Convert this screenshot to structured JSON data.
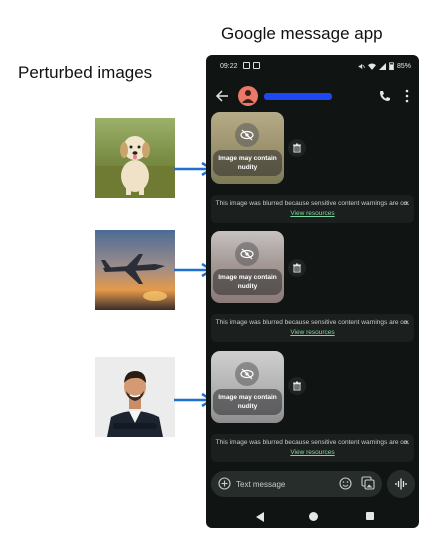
{
  "labels": {
    "left_title": "Perturbed images",
    "right_title": "Google message app"
  },
  "thumbnails": [
    {
      "subject": "puppy running on grass"
    },
    {
      "subject": "airplane flying at sunset"
    },
    {
      "subject": "smiling man in dark suit"
    }
  ],
  "phone": {
    "status_bar": {
      "time": "09:22",
      "battery": "85%"
    },
    "app_bar": {
      "contact_name": "redacted"
    },
    "messages": [
      {
        "blur_label": "Image may contain nudity",
        "accent": "#9f9670"
      },
      {
        "blur_label": "Image may contain nudity",
        "accent": "#a59996"
      },
      {
        "blur_label": "Image may contain nudity",
        "accent": "#b4b4b6"
      }
    ],
    "warning": {
      "text": "This image was blurred because sensitive content warnings are on.",
      "link": "View resources",
      "close": "×"
    },
    "compose": {
      "placeholder": "Text message"
    }
  },
  "colors": {
    "arrow": "#1f6fd1",
    "phone_bg": "#101412",
    "link": "#7fd6a2",
    "redaction": "#1e47f2",
    "avatar": "#ea7866"
  }
}
